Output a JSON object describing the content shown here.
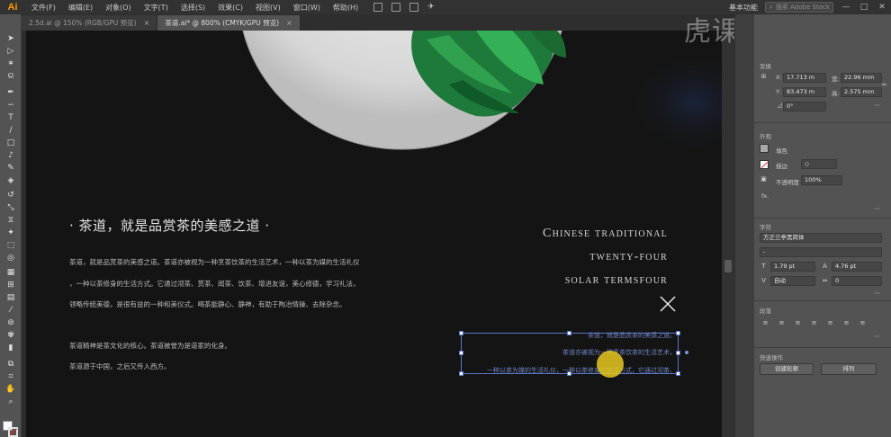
{
  "app": {
    "logo": "Ai"
  },
  "menu": [
    "文件(F)",
    "编辑(E)",
    "对象(O)",
    "文字(T)",
    "选择(S)",
    "效果(C)",
    "视图(V)",
    "窗口(W)",
    "帮助(H)"
  ],
  "workspace": "基本功能",
  "search_placeholder": "搜索 Adobe Stock",
  "window_controls": [
    "—",
    "□",
    "✕"
  ],
  "tabs": [
    {
      "label": "2.5d.ai @ 150% (RGB/GPU 预览)",
      "active": false
    },
    {
      "label": "茶道.ai* @ 800% (CMYK/GPU 预览)",
      "active": true
    }
  ],
  "watermark": "虎课网",
  "artboard": {
    "title": "· 茶道，就是品赏茶的美感之道 ·",
    "paragraphs": [
      "茶道，就是品赏茶的美感之道。茶道亦被视为一种烹茶饮茶的生活艺术，一种以茶为媒的生活礼仪",
      "，一种以茶修身的生活方式。它通过沏茶、赏茶、闻茶、饮茶、增进友谊，美心修德，学习礼法，",
      "领略传统美德，是很有益的一种和美仪式。喝茶能静心、静神，有助于陶冶情操、去除杂念。",
      "茶道精神是茶文化的核心。茶道被誉为是道家的化身。",
      "茶道源于中国，之后又传入西方。"
    ],
    "english": [
      "Chinese traditional",
      "twenty-four",
      "solar termsfour"
    ],
    "selection_lines": [
      "茶道，就是品赏茶的美感之道。",
      "茶道亦被视为一种烹茶饮茶的生活艺术，",
      "一种以茶为媒的生活礼仪，一种以茶修身的生活方式，它通过沏茶、"
    ]
  },
  "panel": {
    "transform_title": "变换",
    "x_label": "X:",
    "x": "17.713 m",
    "y_label": "Y:",
    "y": "83.473 m",
    "w_label": "宽:",
    "w": "22.96 mm",
    "h_label": "高:",
    "h": "2.575 mm",
    "angle": "0°",
    "appearance_title": "外观",
    "fill_label": "填色",
    "stroke_label": "描边",
    "opacity_label": "不透明度",
    "opacity": "100%",
    "fx_label": "fx.",
    "char_title": "字符",
    "font": "方正兰亭黑简体",
    "font_style": "-",
    "font_size": "1.79 pt",
    "leading": "4.76 pt",
    "tracking_mode": "自动",
    "tracking": "0",
    "para_title": "段落",
    "quick_title": "快速操作",
    "btn_outline": "创建轮廓",
    "btn_arrange": "排列"
  }
}
